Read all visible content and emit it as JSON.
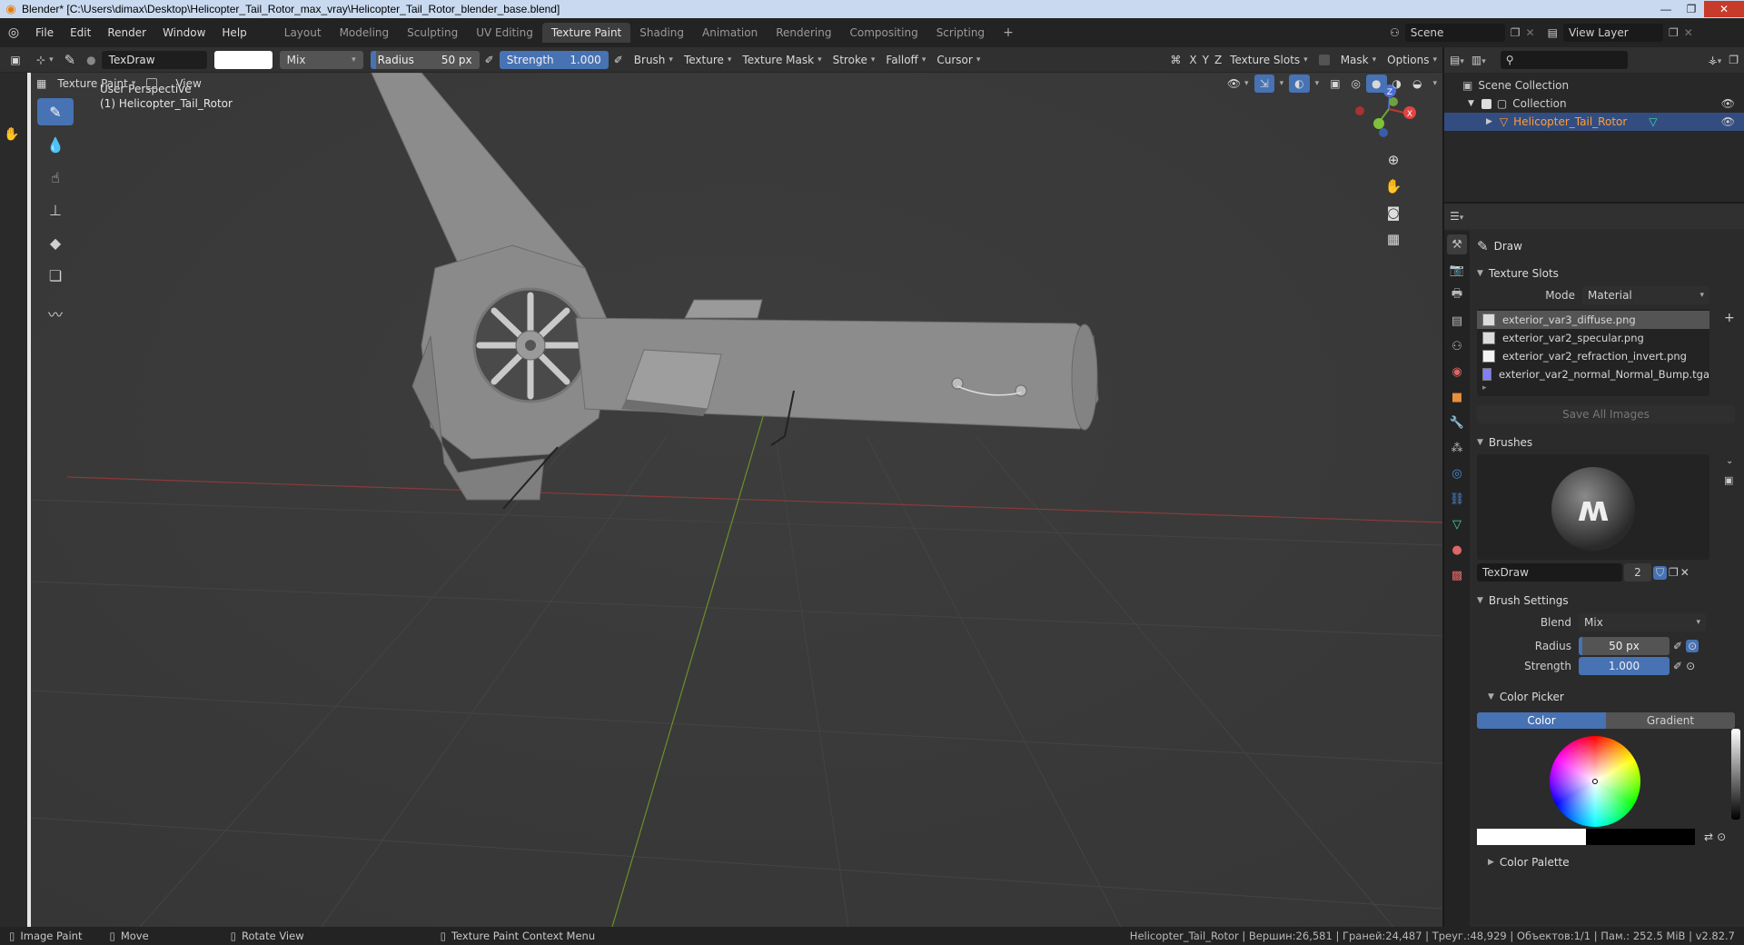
{
  "window": {
    "title": "Blender* [C:\\Users\\dimax\\Desktop\\Helicopter_Tail_Rotor_max_vray\\Helicopter_Tail_Rotor_blender_base.blend]",
    "min": "—",
    "max": "❐",
    "close": "✕"
  },
  "menu": [
    "File",
    "Edit",
    "Render",
    "Window",
    "Help"
  ],
  "workspaces": [
    "Layout",
    "Modeling",
    "Sculpting",
    "UV Editing",
    "Texture Paint",
    "Shading",
    "Animation",
    "Rendering",
    "Compositing",
    "Scripting"
  ],
  "active_workspace": "Texture Paint",
  "scene": {
    "scene_name": "Scene",
    "view_layer": "View Layer"
  },
  "toolbar": {
    "brush_name": "TexDraw",
    "blend": "Mix",
    "radius_label": "Radius",
    "radius_value": "50 px",
    "strength_label": "Strength",
    "strength_value": "1.000",
    "menus": [
      "Brush",
      "Texture",
      "Texture Mask",
      "Stroke",
      "Falloff",
      "Cursor"
    ],
    "axes": [
      "X",
      "Y",
      "Z"
    ],
    "texture_slots": "Texture Slots",
    "mask": "Mask",
    "options": "Options"
  },
  "mode": {
    "mode_name": "Texture Paint",
    "view": "View"
  },
  "viewport": {
    "perspective": "User Perspective",
    "object": "(1) Helicopter_Tail_Rotor",
    "gizmo": {
      "z": "Z",
      "x": "X"
    }
  },
  "outliner": {
    "scene_collection": "Scene Collection",
    "collection": "Collection",
    "object": "Helicopter_Tail_Rotor"
  },
  "properties": {
    "tool_title": "Draw",
    "texture_slots_title": "Texture Slots",
    "mode_label": "Mode",
    "mode_value": "Material",
    "textures": [
      "exterior_var3_diffuse.png",
      "exterior_var2_specular.png",
      "exterior_var2_refraction_invert.png",
      "exterior_var2_normal_Normal_Bump.tga"
    ],
    "save_all": "Save All Images",
    "brushes_title": "Brushes",
    "brush_name": "TexDraw",
    "brush_users": "2",
    "brush_settings_title": "Brush Settings",
    "blend_label": "Blend",
    "blend_value": "Mix",
    "radius_label": "Radius",
    "radius_value": "50 px",
    "strength_label": "Strength",
    "strength_value": "1.000",
    "color_picker_title": "Color Picker",
    "color_tab": "Color",
    "gradient_tab": "Gradient",
    "color_palette_title": "Color Palette"
  },
  "statusbar": {
    "image_paint": "Image Paint",
    "move": "Move",
    "rotate": "Rotate View",
    "context_menu": "Texture Paint Context Menu",
    "stats": "Helicopter_Tail_Rotor | Вершин:26,581 | Граней:24,487 | Треуг.:48,929 | Объектов:1/1 | Пам.: 252.5 MiB | v2.82.7"
  },
  "colors": {
    "accent": "#4772b3",
    "selected_object": "#ff9f3a",
    "viewport_bg": "#3a3a3a"
  }
}
